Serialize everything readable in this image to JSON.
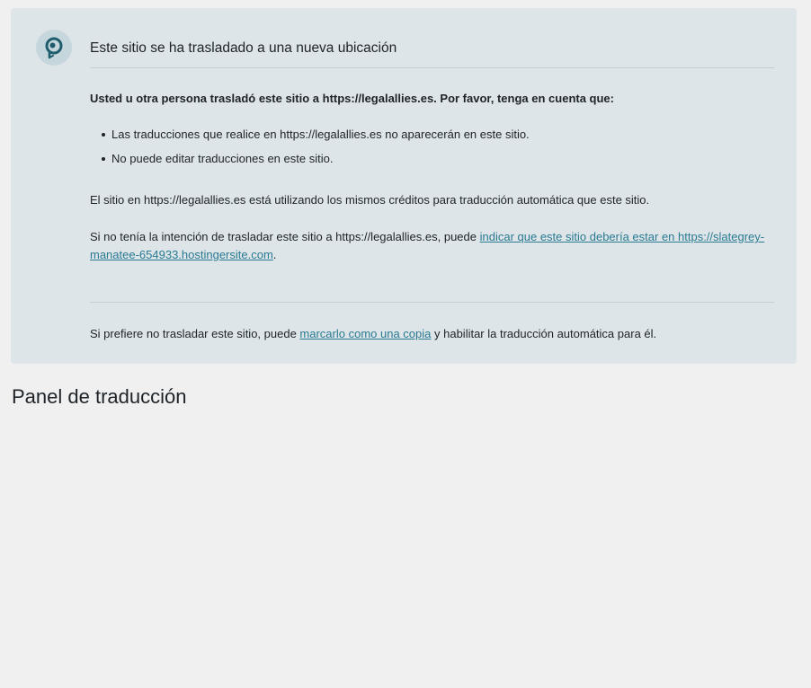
{
  "notice": {
    "title": "Este sitio se ha trasladado a una nueva ubicación",
    "intro": "Usted u otra persona trasladó este sitio a https://legalallies.es. Por favor, tenga en cuenta que:",
    "bullets": [
      "Las traducciones que realice en https://legalallies.es no aparecerán en este sitio.",
      "No puede editar traducciones en este sitio."
    ],
    "credits_text": "El sitio en https://legalallies.es está utilizando los mismos créditos para traducción automática que este sitio.",
    "intent_prefix": "Si no tenía la intención de trasladar este sitio a https://legalallies.es, puede ",
    "intent_link": "indicar que este sitio debería estar en https://slategrey-manatee-654933.hostingersite.com",
    "intent_suffix": ".",
    "copy_prefix": "Si prefiere no trasladar este sitio, puede ",
    "copy_link": "marcarlo como una copia",
    "copy_suffix": " y habilitar la traducción automática para él.",
    "logo_icon": "wpml-logo-icon"
  },
  "page": {
    "title": "Panel de traducción"
  },
  "colors": {
    "background": "#f0f0f1",
    "notice_background": "#dde5e8",
    "link": "#2a7a92",
    "logo_background": "#c5d7dd",
    "logo_mark": "#1f5d6e"
  }
}
